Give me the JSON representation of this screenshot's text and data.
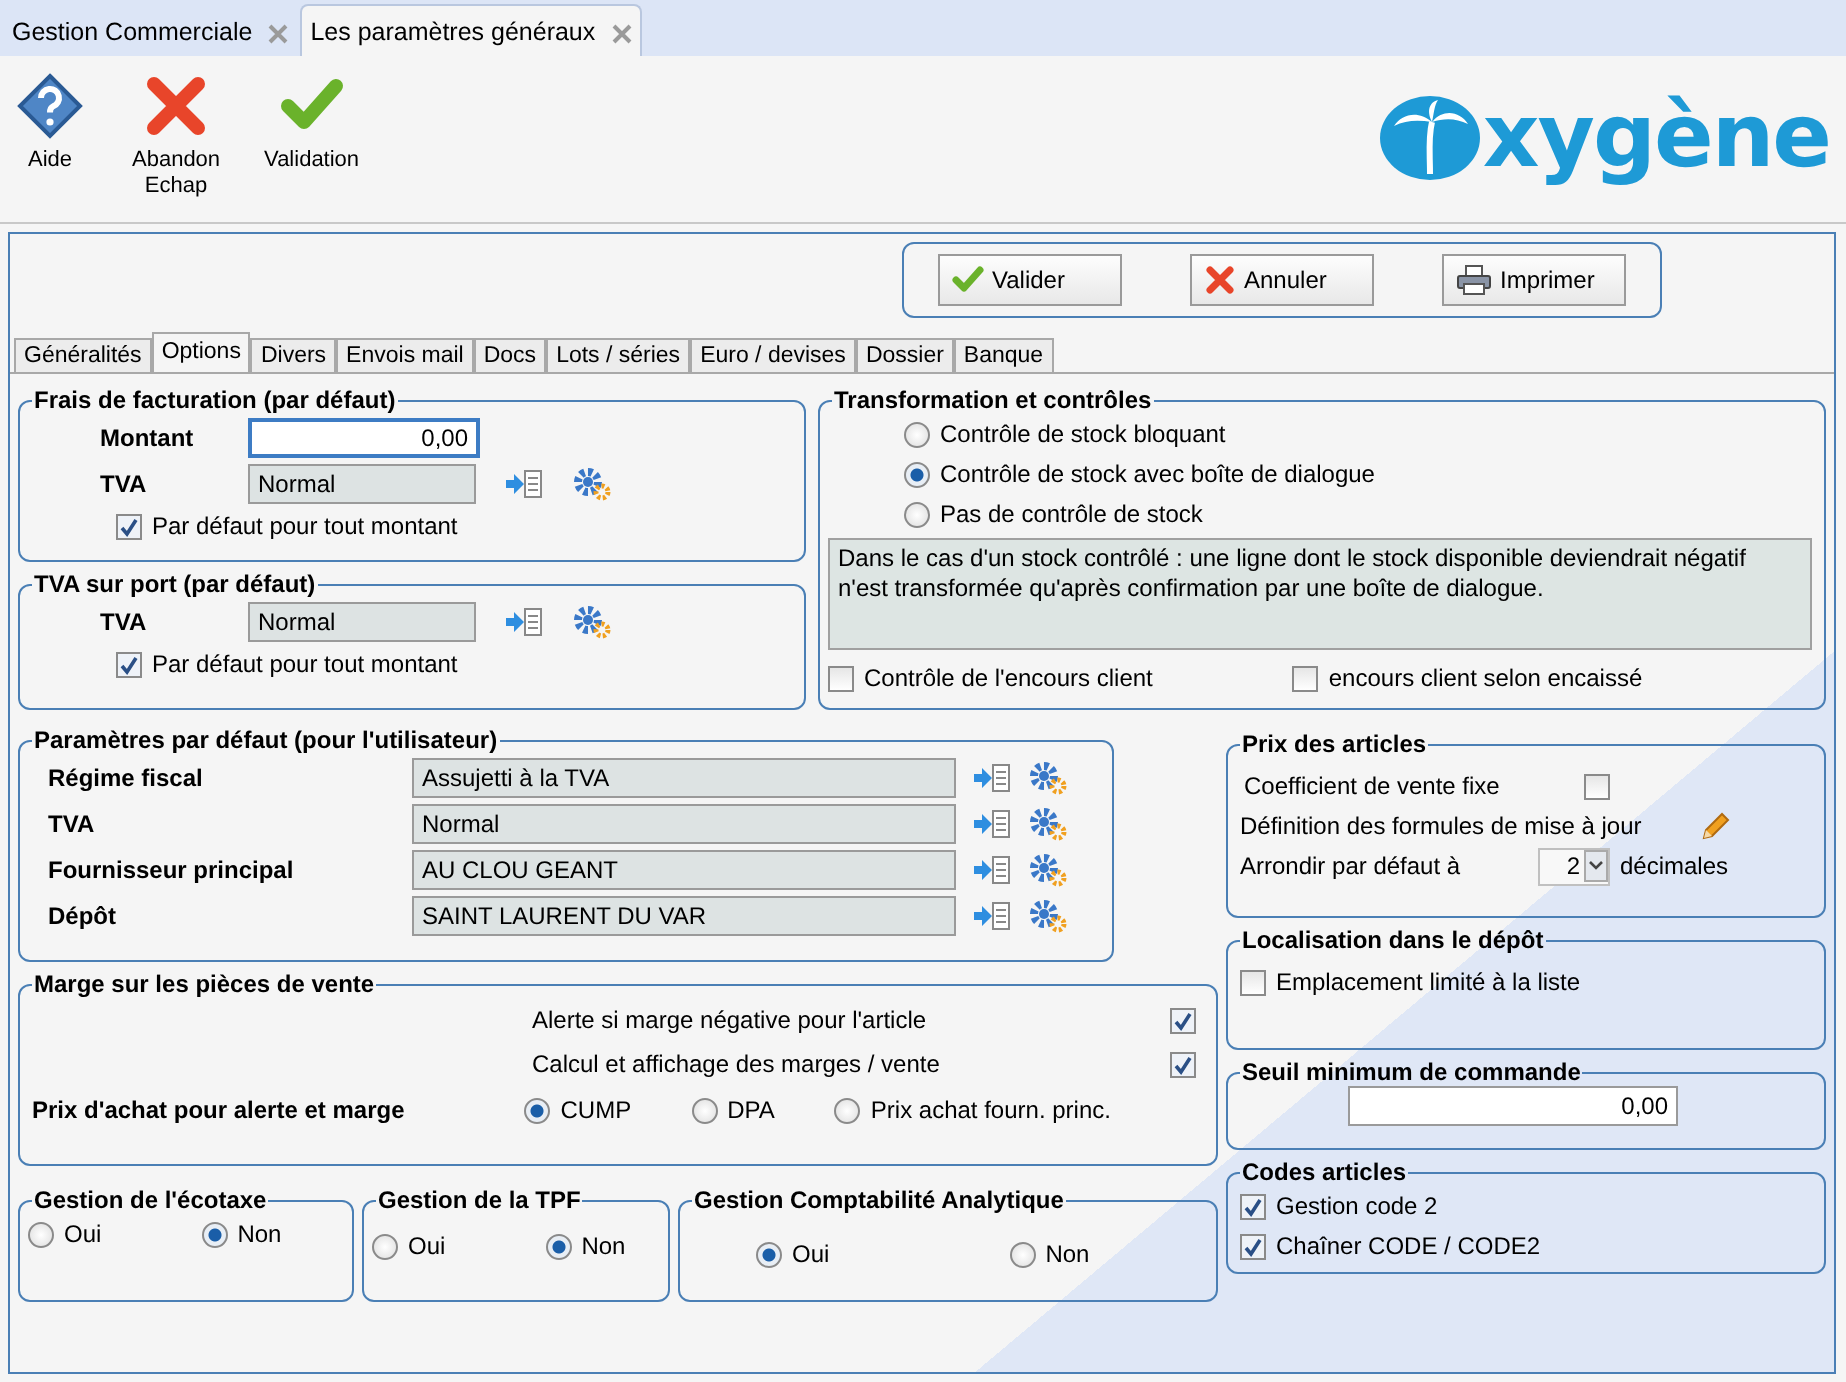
{
  "app_tabs": [
    {
      "label": "Gestion Commerciale",
      "selected": false
    },
    {
      "label": "Les paramètres généraux",
      "selected": true
    }
  ],
  "toolbar": [
    {
      "kind": "help",
      "lines": [
        "Aide"
      ]
    },
    {
      "kind": "cancel",
      "lines": [
        "Abandon",
        "Echap"
      ]
    },
    {
      "kind": "validate",
      "lines": [
        "Validation"
      ]
    }
  ],
  "logo": "xygène",
  "actions": [
    {
      "kind": "validate",
      "label": "Valider"
    },
    {
      "kind": "cancel",
      "label": "Annuler"
    },
    {
      "kind": "print",
      "label": "Imprimer"
    }
  ],
  "tabs": [
    {
      "label": "Généralités",
      "selected": false
    },
    {
      "label": "Options",
      "selected": true
    },
    {
      "label": "Divers",
      "selected": false
    },
    {
      "label": "Envois mail",
      "selected": false
    },
    {
      "label": "Docs",
      "selected": false
    },
    {
      "label": "Lots / séries",
      "selected": false
    },
    {
      "label": "Euro / devises",
      "selected": false
    },
    {
      "label": "Dossier",
      "selected": false
    },
    {
      "label": "Banque",
      "selected": false
    }
  ],
  "frais": {
    "title": "Frais de facturation (par défaut)",
    "montant_label": "Montant",
    "montant": "0,00",
    "tva_label": "TVA",
    "tva": "Normal",
    "default": {
      "label": "Par défaut pour tout montant",
      "checked": true
    }
  },
  "tva_port": {
    "title": "TVA sur port (par défaut)",
    "tva_label": "TVA",
    "tva": "Normal",
    "default": {
      "label": "Par défaut pour tout montant",
      "checked": true
    }
  },
  "transformation": {
    "title": "Transformation et contrôles",
    "options": [
      {
        "label": "Contrôle de stock bloquant",
        "selected": false
      },
      {
        "label": "Contrôle de stock avec boîte de dialogue",
        "selected": true
      },
      {
        "label": "Pas de contrôle de stock",
        "selected": false
      }
    ],
    "note": "Dans le cas d'un stock contrôlé : une ligne dont le stock disponible deviendrait négatif n'est transformée qu'après confirmation par une boîte de dialogue.",
    "checks": [
      {
        "label": "Contrôle de l'encours client",
        "checked": false
      },
      {
        "label": "encours client selon encaissé",
        "checked": false
      }
    ]
  },
  "user_defaults": {
    "title": "Paramètres par défaut (pour l'utilisateur)",
    "rows": [
      {
        "label": "Régime fiscal",
        "value": "Assujetti à la TVA"
      },
      {
        "label": "TVA",
        "value": "Normal"
      },
      {
        "label": "Fournisseur principal",
        "value": "AU CLOU GEANT"
      },
      {
        "label": "Dépôt",
        "value": "SAINT LAURENT DU VAR"
      }
    ]
  },
  "prix": {
    "title": "Prix des articles",
    "coef": {
      "label": "Coefficient de vente fixe",
      "checked": false
    },
    "formulas_label": "Définition des formules de mise à jour",
    "round_label": "Arrondir par défaut à",
    "round_value": "2",
    "round_unit": "décimales"
  },
  "marge": {
    "title": "Marge sur les pièces de vente",
    "checks": [
      {
        "label": "Alerte si marge négative pour l'article",
        "checked": true
      },
      {
        "label": "Calcul et affichage des marges / vente",
        "checked": true
      }
    ],
    "price_label": "Prix d'achat pour alerte et marge",
    "options": [
      {
        "label": "CUMP",
        "selected": true
      },
      {
        "label": "DPA",
        "selected": false
      },
      {
        "label": "Prix achat fourn. princ.",
        "selected": false
      }
    ]
  },
  "localisation": {
    "title": "Localisation dans le dépôt",
    "check": {
      "label": "Emplacement limité à la liste",
      "checked": false
    }
  },
  "seuil": {
    "title": "Seuil minimum de commande",
    "value": "0,00"
  },
  "ecotaxe": {
    "title": "Gestion de l'écotaxe",
    "options": [
      {
        "label": "Oui",
        "selected": false
      },
      {
        "label": "Non",
        "selected": true
      }
    ]
  },
  "tpf": {
    "title": "Gestion de la TPF",
    "options": [
      {
        "label": "Oui",
        "selected": false
      },
      {
        "label": "Non",
        "selected": true
      }
    ]
  },
  "analytique": {
    "title": "Gestion Comptabilité Analytique",
    "options": [
      {
        "label": "Oui",
        "selected": true
      },
      {
        "label": "Non",
        "selected": false
      }
    ]
  },
  "codes": {
    "title": "Codes articles",
    "checks": [
      {
        "label": "Gestion code 2",
        "checked": true
      },
      {
        "label": "Chaîner CODE / CODE2",
        "checked": true
      }
    ]
  }
}
